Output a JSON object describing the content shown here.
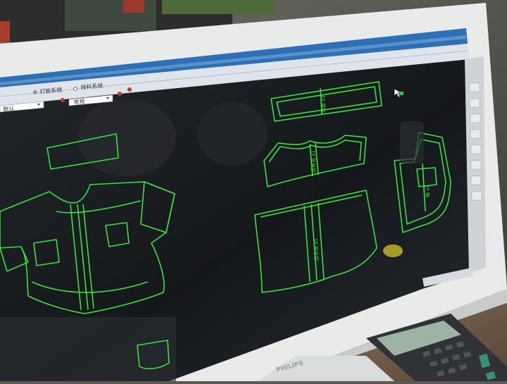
{
  "toolbar": {
    "system_label": "打板系统",
    "system_label_2": "排料系统",
    "dropdown_value": "默认",
    "dropdown_value_2": "常规"
  },
  "monitor": {
    "brand": "PHILIPS"
  },
  "pieces": [
    {
      "name": "collar-strip"
    },
    {
      "name": "front-body-left"
    },
    {
      "name": "pocket-piece"
    },
    {
      "name": "yoke-strip"
    },
    {
      "name": "front-yoke"
    },
    {
      "name": "back-body"
    },
    {
      "name": "sleeve-panel"
    }
  ],
  "colors": {
    "pattern_line": "#39e23d",
    "canvas": "#171a1d",
    "bezel": "#e8eaea",
    "toolbar": "#dfe4ec",
    "desk": "#7a6553"
  },
  "piece_labels": {
    "front_grain": "后衣身 x1",
    "yoke_grain": "后育克 x1",
    "strip_grain": "领面 x2",
    "sleeve_grain": "袖 x2"
  }
}
